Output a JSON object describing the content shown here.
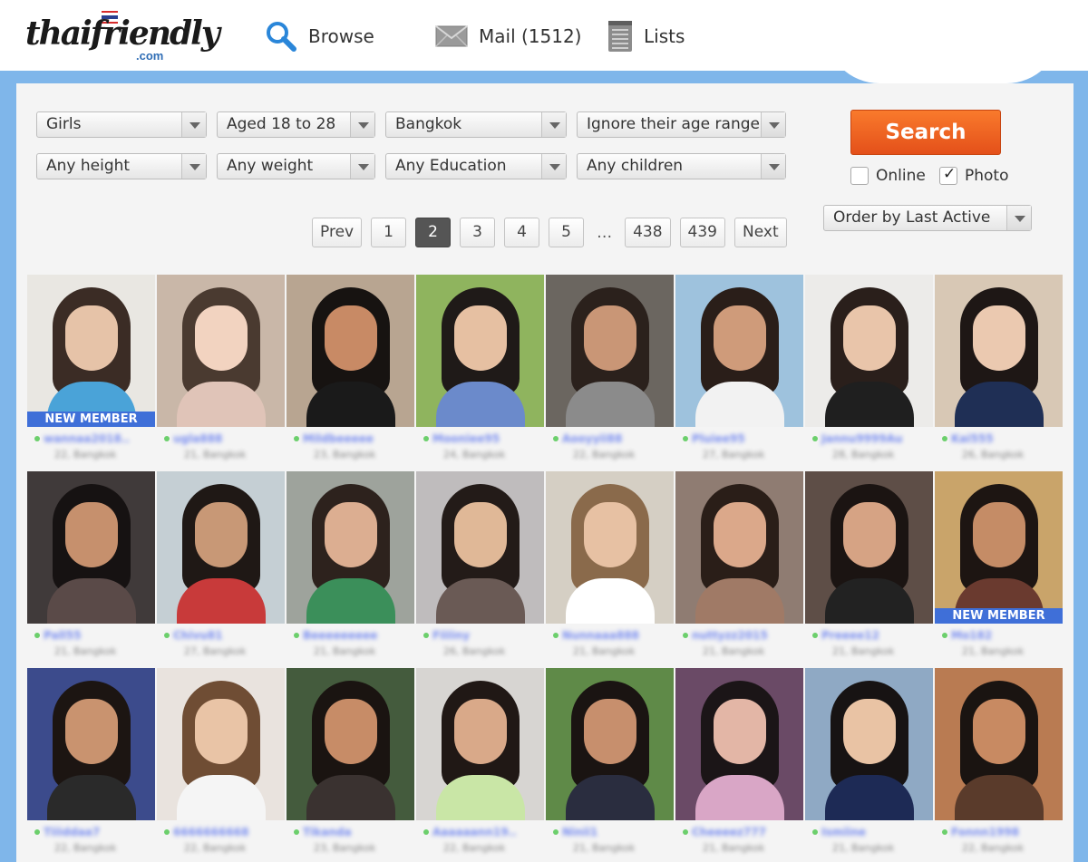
{
  "brand": {
    "logo_text": "thaifriendly",
    "logo_suffix": ".com"
  },
  "nav": {
    "browse": "Browse",
    "mail": "Mail (1512)",
    "lists": "Lists"
  },
  "filters": {
    "gender": "Girls",
    "age": "Aged 18 to 28",
    "location": "Bangkok",
    "age_range": "Ignore their age range",
    "height": "Any height",
    "weight": "Any weight",
    "education": "Any Education",
    "children": "Any children"
  },
  "search": {
    "button_label": "Search",
    "online_label": "Online",
    "online_checked": false,
    "photo_label": "Photo",
    "photo_checked": true,
    "order_by": "Order by Last Active"
  },
  "pagination": {
    "prev": "Prev",
    "pages": [
      "1",
      "2",
      "3",
      "4",
      "5"
    ],
    "current": "2",
    "ellipsis": "…",
    "tail_pages": [
      "438",
      "439"
    ],
    "next": "Next"
  },
  "profiles": [
    {
      "username": "wannaa2018..",
      "info": "22, Bangkok",
      "badge": "NEW MEMBER",
      "bg": "#e9e7e2",
      "hair": "#3b2c25",
      "skin": "#e6c3a8",
      "top": "#4aa3d8"
    },
    {
      "username": "ugla888",
      "info": "21, Bangkok",
      "badge": "",
      "bg": "#c9b7a8",
      "hair": "#4a3a30",
      "skin": "#f2d3c0",
      "top": "#e0c4b8"
    },
    {
      "username": "Mildbeeeee",
      "info": "23, Bangkok",
      "badge": "",
      "bg": "#b8a591",
      "hair": "#171311",
      "skin": "#c88a65",
      "top": "#1a1a1a"
    },
    {
      "username": "Mooniee95",
      "info": "24, Bangkok",
      "badge": "",
      "bg": "#8fb45e",
      "hair": "#1f1a18",
      "skin": "#e6c0a2",
      "top": "#6b8acb"
    },
    {
      "username": "Aooyyii88",
      "info": "22, Bangkok",
      "badge": "",
      "bg": "#6b6660",
      "hair": "#2b211c",
      "skin": "#c99676",
      "top": "#8b8b8b"
    },
    {
      "username": "Pluiee95",
      "info": "27, Bangkok",
      "badge": "",
      "bg": "#9ec2dd",
      "hair": "#2a1e19",
      "skin": "#cf9b7a",
      "top": "#f2f2f2"
    },
    {
      "username": "Jannu9999Au",
      "info": "28, Bangkok",
      "badge": "",
      "bg": "#ecebe9",
      "hair": "#2a1f1b",
      "skin": "#e9c5aa",
      "top": "#1f1f1f"
    },
    {
      "username": "Kai555",
      "info": "26, Bangkok",
      "badge": "",
      "bg": "#d8c8b5",
      "hair": "#1e1715",
      "skin": "#ebc9b0",
      "top": "#1f2f55"
    },
    {
      "username": "Pall55",
      "info": "21, Bangkok",
      "badge": "",
      "bg": "#403a3a",
      "hair": "#161212",
      "skin": "#c6906d",
      "top": "#5a4a48"
    },
    {
      "username": "Chivu81",
      "info": "27, Bangkok",
      "badge": "",
      "bg": "#c5cfd4",
      "hair": "#1f1815",
      "skin": "#c89876",
      "top": "#c83a3a"
    },
    {
      "username": "Beeeeeeeee",
      "info": "21, Bangkok",
      "badge": "",
      "bg": "#9ea39c",
      "hair": "#2d221d",
      "skin": "#dcae91",
      "top": "#3b8f5a"
    },
    {
      "username": "Fiiiiny",
      "info": "26, Bangkok",
      "badge": "",
      "bg": "#bfbcbd",
      "hair": "#231b18",
      "skin": "#e0b897",
      "top": "#6a5a55"
    },
    {
      "username": "Nunnaaa888",
      "info": "21, Bangkok",
      "badge": "",
      "bg": "#d5cfc4",
      "hair": "#8a6a4b",
      "skin": "#e7c1a3",
      "top": "#ffffff"
    },
    {
      "username": "nuttyzz2015",
      "info": "21, Bangkok",
      "badge": "",
      "bg": "#8f7c72",
      "hair": "#2a1e18",
      "skin": "#dba88a",
      "top": "#a07a66"
    },
    {
      "username": "Preeee12",
      "info": "21, Bangkok",
      "badge": "",
      "bg": "#5e4e47",
      "hair": "#1b1412",
      "skin": "#d6a384",
      "top": "#222222"
    },
    {
      "username": "Mo182",
      "info": "21, Bangkok",
      "badge": "NEW MEMBER",
      "bg": "#c9a46a",
      "hair": "#1d1512",
      "skin": "#c58c66",
      "top": "#6a3a2f"
    },
    {
      "username": "Tiiiddaa7",
      "info": "22, Bangkok",
      "badge": "",
      "bg": "#3c4b8c",
      "hair": "#1c1512",
      "skin": "#c9936f",
      "top": "#2a2a2a"
    },
    {
      "username": "6666666668",
      "info": "22, Bangkok",
      "badge": "",
      "bg": "#e9e3de",
      "hair": "#6f4d34",
      "skin": "#e9c4a6",
      "top": "#f5f5f5"
    },
    {
      "username": "Tikanda",
      "info": "23, Bangkok",
      "badge": "",
      "bg": "#445b3d",
      "hair": "#1a1411",
      "skin": "#c78c67",
      "top": "#3a3230"
    },
    {
      "username": "Aaaaaann19..",
      "info": "22, Bangkok",
      "badge": "",
      "bg": "#d7d5d2",
      "hair": "#201815",
      "skin": "#d9a989",
      "top": "#c9e6a6"
    },
    {
      "username": "Ninii1",
      "info": "21, Bangkok",
      "badge": "",
      "bg": "#5f8a48",
      "hair": "#1a1412",
      "skin": "#c78f6d",
      "top": "#2a2d3f"
    },
    {
      "username": "Cheeeez777",
      "info": "21, Bangkok",
      "badge": "",
      "bg": "#6a4a66",
      "hair": "#1b1517",
      "skin": "#e3b6a6",
      "top": "#d9a6c6"
    },
    {
      "username": "Ismiine",
      "info": "21, Bangkok",
      "badge": "",
      "bg": "#8fa9c4",
      "hair": "#171313",
      "skin": "#e9c3a4",
      "top": "#1d2a55"
    },
    {
      "username": "Fonnn1998",
      "info": "22, Bangkok",
      "badge": "",
      "bg": "#b97b52",
      "hair": "#1a1411",
      "skin": "#c88a62",
      "top": "#5a3b2b"
    }
  ]
}
